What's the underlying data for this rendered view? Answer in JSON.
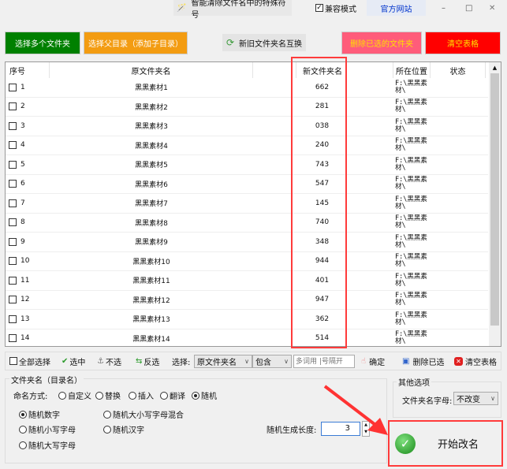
{
  "titlebar": {
    "tool_label": "智能清除文件名中的特殊符号",
    "compat_label": "兼容模式",
    "compat_checked": true,
    "website_label": "官方网站",
    "minimize": "–",
    "maximize": "□",
    "close": "✕"
  },
  "toolbar": {
    "select_folders": "选择多个文件夹",
    "select_parent": "选择父目录（添加子目录）",
    "swap_names": "新旧文件夹名互换",
    "delete_selected": "删除已选的文件夹",
    "clear_table": "清空表格"
  },
  "colors": {
    "green": "#008000",
    "orange": "#f39c12",
    "pink": "#ff5c7a",
    "red": "#ff0000",
    "highlight": "#ff3b3b"
  },
  "table": {
    "headers": {
      "seq": "序号",
      "original": "原文件夹名",
      "new": "新文件夹名",
      "location": "所在位置",
      "status": "状态"
    },
    "rows": [
      {
        "seq": "1",
        "original": "黑黑素材1",
        "new": "662",
        "location": "F:\\黑黑素材\\",
        "status": ""
      },
      {
        "seq": "2",
        "original": "黑黑素材2",
        "new": "281",
        "location": "F:\\黑黑素材\\",
        "status": ""
      },
      {
        "seq": "3",
        "original": "黑黑素材3",
        "new": "038",
        "location": "F:\\黑黑素材\\",
        "status": ""
      },
      {
        "seq": "4",
        "original": "黑黑素材4",
        "new": "240",
        "location": "F:\\黑黑素材\\",
        "status": ""
      },
      {
        "seq": "5",
        "original": "黑黑素材5",
        "new": "743",
        "location": "F:\\黑黑素材\\",
        "status": ""
      },
      {
        "seq": "6",
        "original": "黑黑素材6",
        "new": "547",
        "location": "F:\\黑黑素材\\",
        "status": ""
      },
      {
        "seq": "7",
        "original": "黑黑素材7",
        "new": "145",
        "location": "F:\\黑黑素材\\",
        "status": ""
      },
      {
        "seq": "8",
        "original": "黑黑素材8",
        "new": "740",
        "location": "F:\\黑黑素材\\",
        "status": ""
      },
      {
        "seq": "9",
        "original": "黑黑素材9",
        "new": "348",
        "location": "F:\\黑黑素材\\",
        "status": ""
      },
      {
        "seq": "10",
        "original": "黑黑素材10",
        "new": "944",
        "location": "F:\\黑黑素材\\",
        "status": ""
      },
      {
        "seq": "11",
        "original": "黑黑素材11",
        "new": "401",
        "location": "F:\\黑黑素材\\",
        "status": ""
      },
      {
        "seq": "12",
        "original": "黑黑素材12",
        "new": "947",
        "location": "F:\\黑黑素材\\",
        "status": ""
      },
      {
        "seq": "13",
        "original": "黑黑素材13",
        "new": "362",
        "location": "F:\\黑黑素材\\",
        "status": ""
      },
      {
        "seq": "14",
        "original": "黑黑素材14",
        "new": "514",
        "location": "F:\\黑黑素材\\",
        "status": ""
      }
    ]
  },
  "selection_bar": {
    "select_all": "全部选择",
    "check": "选中",
    "uncheck": "不选",
    "invert": "反选",
    "select_label": "选择:",
    "field_value": "原文件夹名",
    "match_value": "包含",
    "keyword_placeholder": "多词用 |号隔开",
    "confirm": "确定",
    "delete_selected": "删除已选",
    "clear_table": "清空表格"
  },
  "naming": {
    "group_title": "文件夹名（目录名）",
    "mode_label": "命名方式:",
    "modes": [
      "自定义",
      "替换",
      "插入",
      "翻译",
      "随机"
    ],
    "mode_selected": "随机",
    "random_options": [
      "随机数字",
      "随机大小写字母混合",
      "随机小写字母",
      "随机汉字",
      "随机大写字母"
    ],
    "random_selected": "随机数字",
    "length_label": "随机生成长度:",
    "length_value": "3"
  },
  "other": {
    "group_title": "其他选项",
    "case_label": "文件夹名字母:",
    "case_value": "不改变"
  },
  "start_button": "开始改名"
}
